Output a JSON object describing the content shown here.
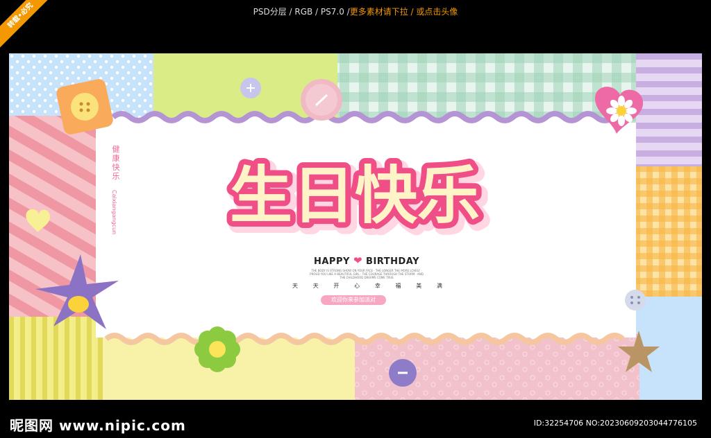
{
  "topbar": {
    "part1": "PSD分层 / RGB / PS7.0 / ",
    "part2": "更多素材请下拉 / 或点击头像",
    "corner_badge": "转载•必究"
  },
  "poster": {
    "title": "生日快乐",
    "subtitle_left": "HAPPY",
    "subtitle_right": "BIRTHDAY",
    "fine_print": "THE BODY IS STRONG SHOW ON YOUR FACE · THE LONGER THE MORE LOVELY · PROUD YOU LIKE A BEAUTIFUL GIRL · THE COURAGE THROUGH THE STORM · AND THE CHILDHOOD DREAMS COME TRUE",
    "days": [
      "天",
      "天",
      "开",
      "心",
      "幸",
      "福",
      "美",
      "满"
    ],
    "pill": "欢迎你来参加派对",
    "vertical_text": "健康快乐",
    "vertical_pinyin": "Caixiangangcun",
    "colors": {
      "title_pink": "#ef4f86",
      "title_cream": "#fff4c8",
      "bg_blue": "#c7e3fb",
      "bg_green": "#d9ec86",
      "bg_lilac": "#c9aee2",
      "bg_pink": "#f2b8c8",
      "bg_yellow": "#f8f1a8",
      "gingham": "#9fd3b8",
      "orange_check": "#f9b646"
    },
    "icons": [
      "button-icon",
      "heart-icon",
      "flower-icon",
      "star-icon",
      "daisy-icon"
    ]
  },
  "footer": {
    "logo": "昵图网 www.nipic.com",
    "image_id": "ID:32254706 NO:20230609203044776105"
  }
}
